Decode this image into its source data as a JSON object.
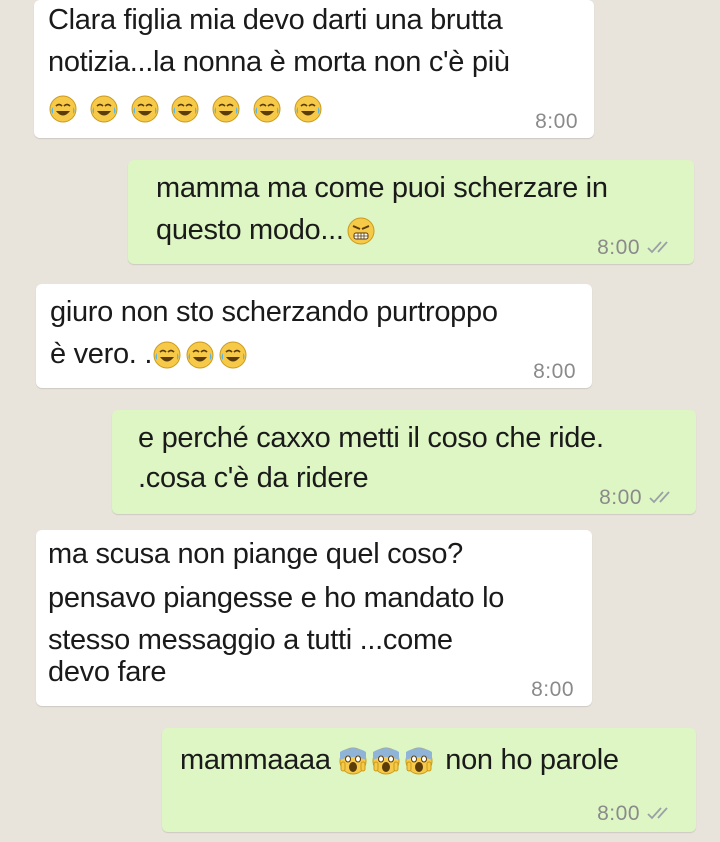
{
  "messages": [
    {
      "direction": "in",
      "lines": [
        "Clara figlia mia devo darti una brutta",
        "notizia...la nonna è morta non c'è più"
      ],
      "time": "8:00"
    },
    {
      "direction": "out",
      "line1": "mamma ma come puoi scherzare in",
      "line2": "questo modo...",
      "time": "8:00"
    },
    {
      "direction": "in",
      "line1": "giuro non sto scherzando purtroppo",
      "line2": "è vero. .",
      "time": "8:00"
    },
    {
      "direction": "out",
      "lines": [
        "e perché caxxo metti il coso che ride.",
        ".cosa c'è da ridere"
      ],
      "time": "8:00"
    },
    {
      "direction": "in",
      "lines": [
        "ma scusa non piange quel coso?",
        "pensavo piangesse e ho mandato lo",
        "stesso messaggio a tutti ...come",
        "devo fare"
      ],
      "time": "8:00"
    },
    {
      "direction": "out",
      "before": "mammaaaa",
      "after": "non ho parole",
      "time": "8:00"
    }
  ],
  "emoji": {
    "laughing": "laughing-tears-emoji",
    "angry": "angry-emoji",
    "screaming": "screaming-emoji"
  },
  "colors": {
    "incoming": "#ffffff",
    "outgoing": "#ddf6c4",
    "background": "#e8e4dc",
    "ticks": "#9aa0a6"
  }
}
